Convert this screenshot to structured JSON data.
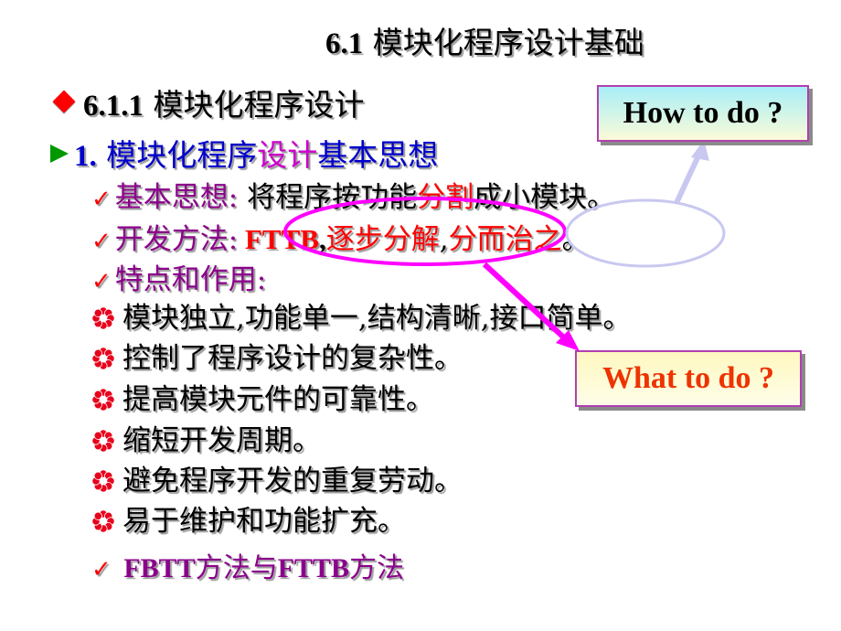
{
  "slide": {
    "title_num": "6.1",
    "title_text": " 模块化程序设计基础",
    "section_num": "6.1.1",
    "section_text": " 模块化程序设计",
    "sub_num": "1.",
    "sub_text_a": " 模块化程序",
    "sub_text_b": "设计",
    "sub_text_c": "基本思想",
    "check_glyph": "✓",
    "line1": {
      "label": "基本思想:",
      "text_a": " 将程序按功能",
      "text_b": "分割",
      "text_c": "成小模块。"
    },
    "line2": {
      "label": "开发方法:",
      "text_a": " FTTB",
      "text_b": ",",
      "text_c": "逐步分解",
      "text_d": ",",
      "text_e": "分而治之",
      "text_f": "。"
    },
    "line3": {
      "label": "特点和作用:"
    },
    "bullets": [
      "模块独立,功能单一,结构清晰,接口简单。",
      "控制了程序设计的复杂性。",
      "提高模块元件的可靠性。",
      "缩短开发周期。",
      "避免程序开发的重复劳动。",
      "易于维护和功能扩充。"
    ],
    "last": {
      "en1": "FBTT",
      "cn1": "方法与",
      "en2": "FTTB",
      "cn2": "方法"
    },
    "how_box": "How to do ?",
    "what_box": "What to do ?"
  },
  "colors": {
    "accent_red": "#ff0000",
    "section_blue": "#0000cc",
    "label_purple": "#8b008b",
    "callout_magenta": "#ff00ff",
    "callout_lavender": "#c8c8f0",
    "what_text": "#ee3300"
  },
  "icons": {
    "diamond": "red-diamond-bullet",
    "arrow": "green-arrow-bullet",
    "check": "red-check-bullet",
    "flower": "red-flower-bullet"
  }
}
